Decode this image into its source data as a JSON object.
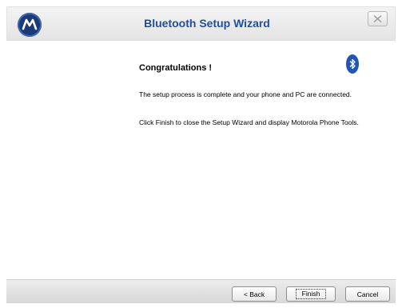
{
  "window": {
    "title": "Bluetooth Setup Wizard"
  },
  "content": {
    "heading": "Congratulations !",
    "paragraph1": "The setup process is complete and your phone and PC are connected.",
    "paragraph2": "Click Finish to close the Setup Wizard and display Motorola Phone Tools."
  },
  "buttons": {
    "back": "< Back",
    "finish": "Finish",
    "cancel": "Cancel"
  },
  "colors": {
    "title": "#1f4fa0",
    "brand": "#1a3a7a",
    "bluetooth": "#1f56b8"
  }
}
